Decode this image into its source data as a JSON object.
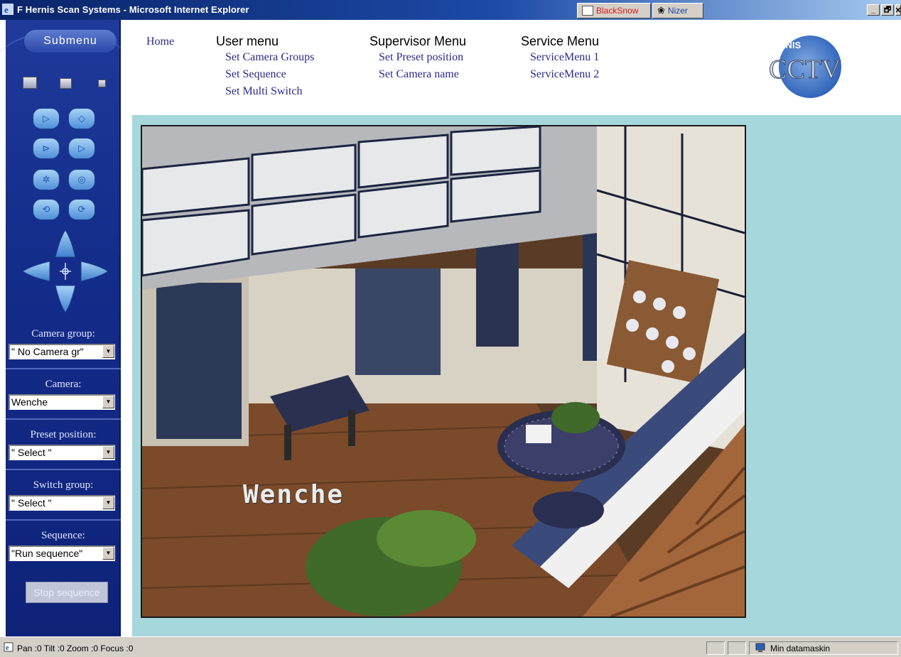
{
  "window": {
    "title": "F Hernis Scan Systems - Microsoft Internet Explorer",
    "taskbar_buttons": [
      "BlackSnow",
      "Nizer"
    ],
    "controls": [
      "_",
      "🗗",
      "✕"
    ]
  },
  "sidebar": {
    "submenu_label": "Submenu",
    "camera_group": {
      "label": "Camera group:",
      "value": "\" No Camera gr\""
    },
    "camera": {
      "label": "Camera:",
      "value": "Wenche"
    },
    "preset_position": {
      "label": "Preset position:",
      "value": "\" Select \""
    },
    "switch_group": {
      "label": "Switch group:",
      "value": "\" Select \""
    },
    "sequence": {
      "label": "Sequence:",
      "value": "\"Run sequence\""
    },
    "stop_sequence_label": "Stop sequence",
    "icons": {
      "ptz": [
        "play-icon",
        "play-outline-icon",
        "step-icon",
        "step-outline-icon",
        "iris-icon",
        "iris-outline-icon",
        "loop-icon",
        "loop-outline-icon"
      ],
      "dpad": [
        "arrow-up-icon",
        "arrow-left-icon",
        "center-move-icon",
        "arrow-right-icon",
        "arrow-down-icon"
      ]
    }
  },
  "nav": {
    "home": "Home",
    "user_menu": {
      "heading": "User menu",
      "items": [
        "Set Camera Groups",
        "Set Sequence",
        "Set Multi Switch"
      ]
    },
    "supervisor_menu": {
      "heading": "Supervisor Menu",
      "items": [
        "Set Preset position",
        "Set Camera name"
      ]
    },
    "service_menu": {
      "heading": "Service Menu",
      "items": [
        "ServiceMenu 1",
        "ServiceMenu 2"
      ]
    },
    "logo": {
      "top": "HERNIS",
      "main": "CCTV"
    }
  },
  "camera_view": {
    "overlay_label": "Wenche"
  },
  "status": {
    "text": "Pan :0  Tilt :0  Zoom :0  Focus :0",
    "zone": "Min datamaskin"
  },
  "colors": {
    "sidebar": "#142c8a",
    "main_bg": "#a5d7dc",
    "link": "#2a2a8a",
    "ptz_button": "#4f8fd9"
  }
}
